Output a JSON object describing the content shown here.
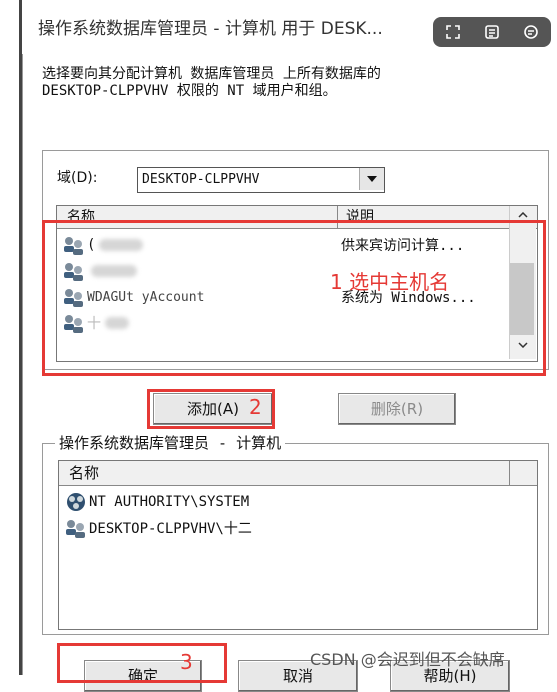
{
  "window": {
    "title": "操作系统数据库管理员 - 计算机 用于 DESK..."
  },
  "description": "选择要向其分配计算机 数据库管理员 上所有数据库的\nDESKTOP-CLPPVHV 权限的 NT 域用户和组。",
  "domain": {
    "label": "域(D):",
    "value": "DESKTOP-CLPPVHV"
  },
  "available_list": {
    "col_name": "名称",
    "col_desc": "说明",
    "rows": [
      {
        "name": "(",
        "desc": "供来宾访问计算..."
      },
      {
        "name": "",
        "desc": ""
      },
      {
        "name": "WDAGUt    yAccount",
        "desc": "系统为 Windows..."
      },
      {
        "name": "十",
        "desc": ""
      }
    ]
  },
  "buttons": {
    "add": "添加(A)",
    "remove": "删除(R)",
    "ok": "确定",
    "cancel": "取消",
    "help": "帮助(H)"
  },
  "annotations": {
    "a1_num": "1",
    "a1_text": "选中主机名",
    "a2": "2",
    "a3": "3"
  },
  "selected_group": {
    "title": "操作系统数据库管理员 - 计算机",
    "col_name": "名称",
    "rows": [
      {
        "name": "NT AUTHORITY\\SYSTEM",
        "icon": "system-group-icon"
      },
      {
        "name": "DESKTOP-CLPPVHV\\十二",
        "icon": "user-group-icon"
      }
    ]
  },
  "watermark": "CSDN @会迟到但不会缺席",
  "colors": {
    "annotation": "#e53935"
  }
}
